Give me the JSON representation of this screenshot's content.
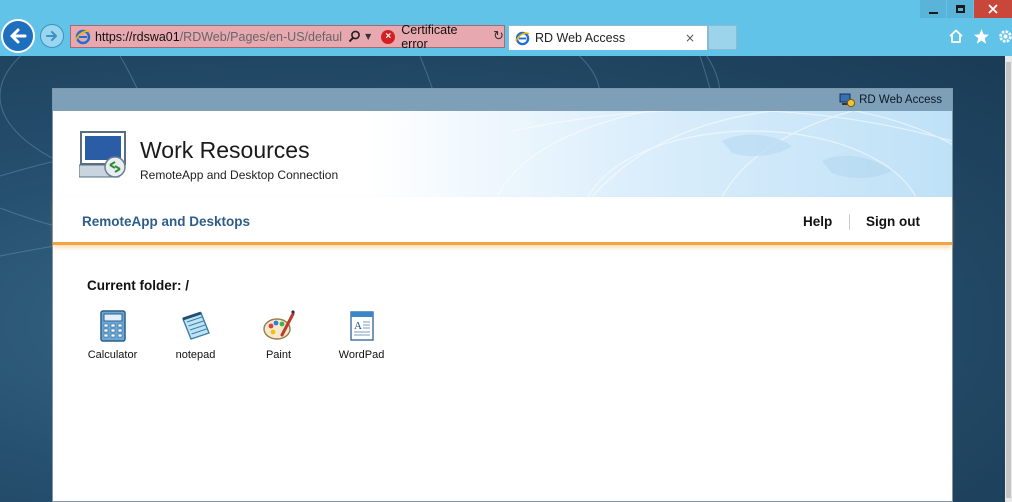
{
  "browser": {
    "address_host": "https://rdswa01",
    "address_path": "/RDWeb/Pages/en-US/default.a",
    "certificate_label": "Certificate error",
    "tab_title": "RD Web Access",
    "tab_close": "×"
  },
  "panel": {
    "top_label": "RD Web Access",
    "title": "Work Resources",
    "subtitle": "RemoteApp and Desktop Connection",
    "nav_main": "RemoteApp and Desktops",
    "nav_help": "Help",
    "nav_signout": "Sign out",
    "current_folder": "Current folder: /"
  },
  "apps": [
    {
      "label": "Calculator",
      "icon": "calculator-icon"
    },
    {
      "label": "notepad",
      "icon": "notepad-icon"
    },
    {
      "label": "Paint",
      "icon": "paint-icon"
    },
    {
      "label": "WordPad",
      "icon": "wordpad-icon"
    }
  ],
  "colors": {
    "chrome": "#62c3e9",
    "address_error": "#e8a8b0",
    "panel_bar": "#7e9fb8",
    "nav_link": "#2e5d8a",
    "accent_orange": "#f3a341"
  }
}
